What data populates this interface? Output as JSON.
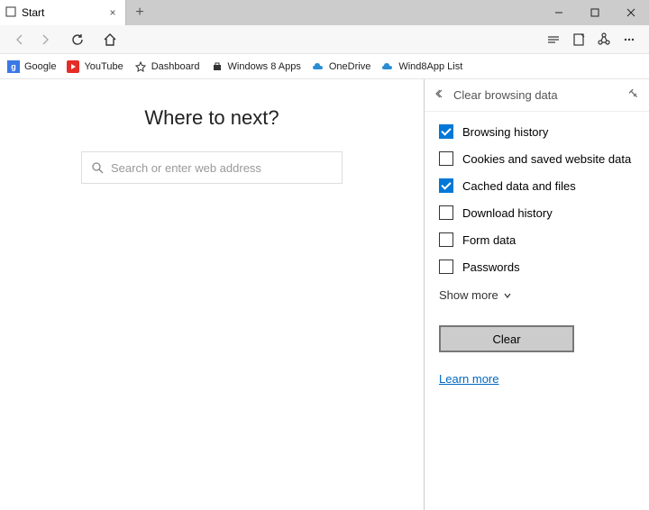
{
  "tab": {
    "title": "Start"
  },
  "favorites": [
    {
      "label": "Google",
      "icon": "google"
    },
    {
      "label": "YouTube",
      "icon": "youtube"
    },
    {
      "label": "Dashboard",
      "icon": "star"
    },
    {
      "label": "Windows 8 Apps",
      "icon": "store"
    },
    {
      "label": "OneDrive",
      "icon": "onedrive"
    },
    {
      "label": "Wind8App List",
      "icon": "onedrive"
    }
  ],
  "main": {
    "heading": "Where to next?",
    "search_placeholder": "Search or enter web address"
  },
  "panel": {
    "title": "Clear browsing data",
    "items": [
      {
        "label": "Browsing history",
        "checked": true
      },
      {
        "label": "Cookies and saved website data",
        "checked": false
      },
      {
        "label": "Cached data and files",
        "checked": true
      },
      {
        "label": "Download history",
        "checked": false
      },
      {
        "label": "Form data",
        "checked": false
      },
      {
        "label": "Passwords",
        "checked": false
      }
    ],
    "show_more": "Show more",
    "clear_button": "Clear",
    "learn_more": "Learn more"
  }
}
